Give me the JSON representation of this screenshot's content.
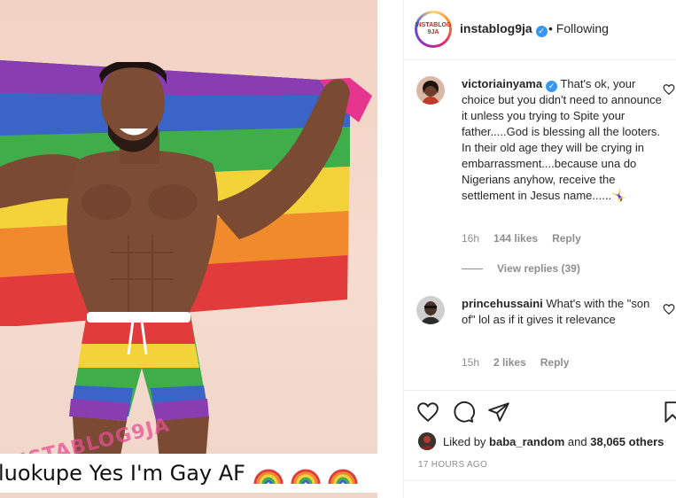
{
  "post": {
    "caption_overlay": "luokupe Yes I'm Gay AF",
    "watermark": "INSTABLOG9JA"
  },
  "header": {
    "avatar_text": "INSTABLOG 9JA",
    "username": "instablog9ja",
    "separator": "•",
    "follow_status": "Following"
  },
  "comments": [
    {
      "username": "victoriainyama",
      "verified": true,
      "text": "That's ok, your choice but you didn't need to announce it unless you trying to Spite your father.....God is blessing all the looters. In their old age they will be crying in embarrassment....because una do Nigerians anyhow, receive the settlement in Jesus name......🤸‍♀️",
      "time": "16h",
      "likes": "144 likes",
      "reply_label": "Reply",
      "view_replies": "View replies (39)"
    },
    {
      "username": "princehussaini",
      "verified": false,
      "text": "What's with the \"son of\" lol as if it gives it relevance",
      "time": "15h",
      "likes": "2 likes",
      "reply_label": "Reply"
    }
  ],
  "likes": {
    "prefix": "Liked by",
    "user": "baba_random",
    "and": "and",
    "others": "38,065 others"
  },
  "timestamp": "17 HOURS AGO",
  "colors": {
    "verified": "#3897f0",
    "muted": "#8e8e8e",
    "text": "#262626"
  },
  "icons": [
    "heart-icon",
    "comment-icon",
    "share-icon",
    "bookmark-icon"
  ]
}
